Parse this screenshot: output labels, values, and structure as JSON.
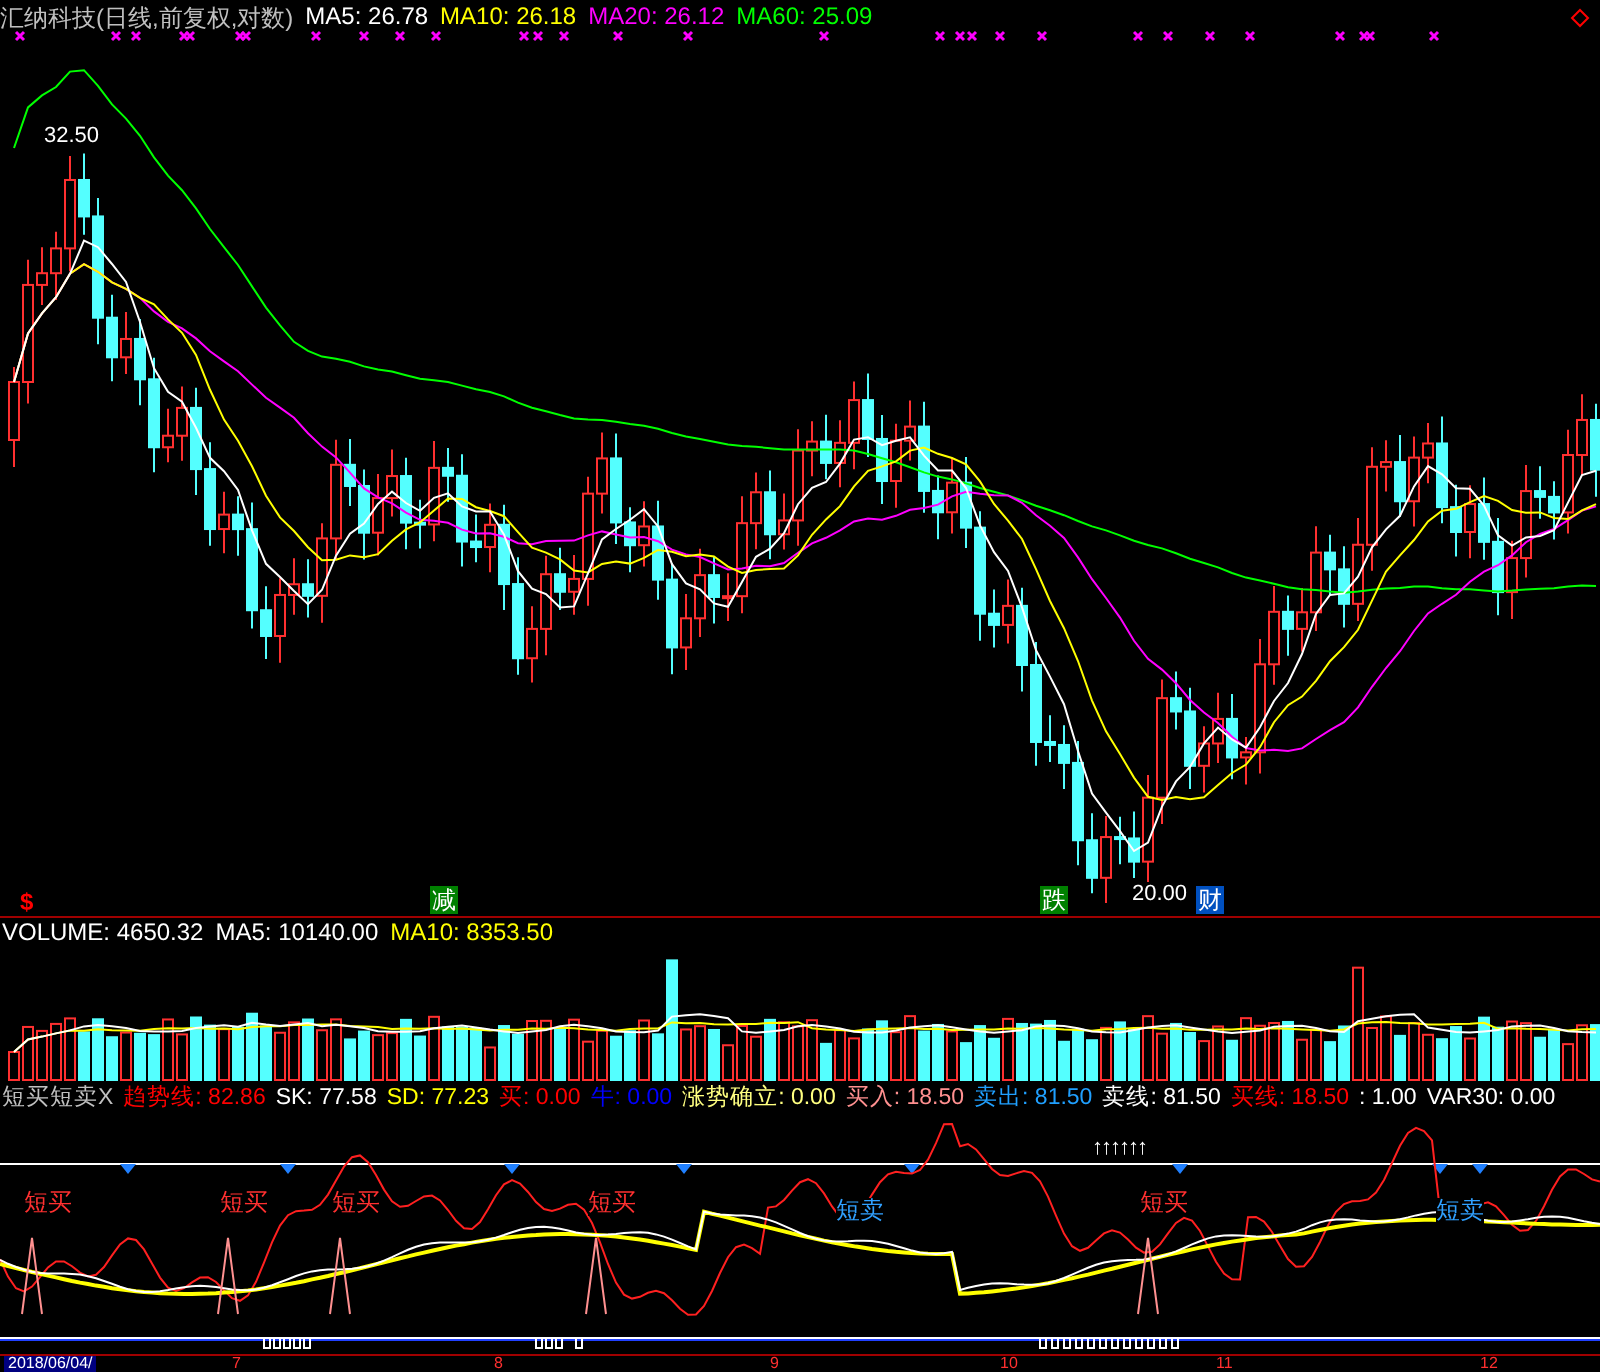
{
  "header": {
    "title": {
      "text": "汇纳科技(日线,前复权,对数)",
      "color": "#c0c0c0"
    },
    "indicators": [
      {
        "text": "MA5: 26.78",
        "color": "#ffffff"
      },
      {
        "text": "MA10: 26.18",
        "color": "#ffff00"
      },
      {
        "text": "MA20: 26.12",
        "color": "#ff00ff"
      },
      {
        "text": "MA60: 25.09",
        "color": "#00ff00"
      }
    ]
  },
  "main_chart": {
    "price_labels": [
      {
        "text": "32.50",
        "kind": "high"
      },
      {
        "text": "20.00",
        "kind": "low"
      }
    ],
    "event_markers": [
      {
        "text": "$",
        "kind": "plain",
        "color": "#ff0000"
      },
      {
        "text": "减",
        "kind": "boxed",
        "color": "#008000"
      },
      {
        "text": "跌",
        "kind": "boxed",
        "color": "#008000"
      },
      {
        "text": "财",
        "kind": "boxed",
        "color": "#0050c0"
      }
    ]
  },
  "volume": {
    "items": [
      {
        "text": "VOLUME: 4650.32",
        "color": "#ffffff"
      },
      {
        "text": "MA5: 10140.00",
        "color": "#ffffff"
      },
      {
        "text": "MA10: 8353.50",
        "color": "#ffff00"
      }
    ]
  },
  "indicator": {
    "items": [
      {
        "text": "短买短卖X",
        "color": "#c0c0c0"
      },
      {
        "text": "趋势线: 82.86",
        "color": "#ff0000"
      },
      {
        "text": "SK: 77.58",
        "color": "#ffffff"
      },
      {
        "text": "SD: 77.23",
        "color": "#ffff00"
      },
      {
        "text": "买: 0.00",
        "color": "#ff0000"
      },
      {
        "text": "牛: 0.00",
        "color": "#0000ff"
      },
      {
        "text": "涨势确立: 0.00",
        "color": "#ffff80"
      },
      {
        "text": "买入: 18.50",
        "color": "#ff9090"
      },
      {
        "text": "卖出: 81.50",
        "color": "#20a0ff"
      },
      {
        "text": "卖线: 81.50",
        "color": "#ffffff"
      },
      {
        "text": "买线: 18.50",
        "color": "#ff0000"
      },
      {
        "text": ": 1.00",
        "color": "#ffffff"
      },
      {
        "text": "VAR30: 0.00",
        "color": "#ffffff"
      }
    ],
    "arrows": "↑↑↑↑↑↑",
    "signals": [
      {
        "text": "短买",
        "kind": "buy"
      },
      {
        "text": "短买",
        "kind": "buy"
      },
      {
        "text": "短买",
        "kind": "buy"
      },
      {
        "text": "短买",
        "kind": "buy"
      },
      {
        "text": "短卖",
        "kind": "sell"
      },
      {
        "text": "短买",
        "kind": "buy"
      },
      {
        "text": "短卖",
        "kind": "sell"
      }
    ]
  },
  "time_axis": {
    "date": "2018/06/04/",
    "months": [
      "7",
      "8",
      "9",
      "10",
      "11",
      "12"
    ]
  }
}
